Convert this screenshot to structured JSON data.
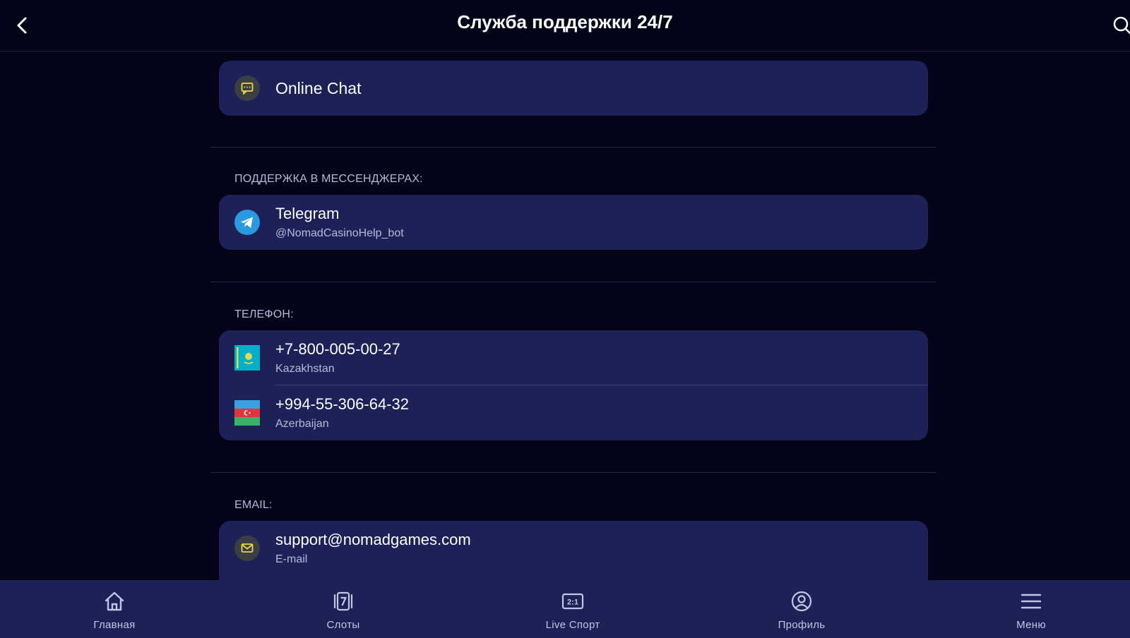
{
  "header": {
    "title": "Служба поддержки 24/7",
    "back_icon": "chevron-left-icon",
    "search_icon": "search-icon"
  },
  "online_chat": {
    "label": "Online Chat",
    "icon": "chat-icon"
  },
  "messengers": {
    "section_label": "ПОДДЕРЖКА В МЕССЕНДЖЕРАХ:",
    "items": [
      {
        "title": "Telegram",
        "subtitle": "@NomadCasinoHelp_bot",
        "icon": "telegram-icon"
      }
    ]
  },
  "phone": {
    "section_label": "ТЕЛЕФОН:",
    "items": [
      {
        "title": "+7-800-005-00-27",
        "subtitle": "Kazakhstan",
        "icon": "kazakhstan-flag-icon"
      },
      {
        "title": "+994-55-306-64-32",
        "subtitle": "Azerbaijan",
        "icon": "azerbaijan-flag-icon"
      }
    ]
  },
  "email": {
    "section_label": "EMAIL:",
    "items": [
      {
        "title": "support@nomadgames.com",
        "subtitle": "E-mail",
        "icon": "mail-icon"
      }
    ]
  },
  "nav": {
    "items": [
      {
        "label": "Главная",
        "icon": "home-icon"
      },
      {
        "label": "Слоты",
        "icon": "slots-icon"
      },
      {
        "label": "Live Спорт",
        "icon": "live-sport-icon"
      },
      {
        "label": "Профиль",
        "icon": "profile-icon"
      },
      {
        "label": "Меню",
        "icon": "menu-icon"
      }
    ]
  },
  "colors": {
    "background": "#03041a",
    "card": "#1d2158",
    "accent_yellow": "#e8d84a",
    "telegram_blue": "#2a9ae0",
    "muted_text": "#b6bad6"
  }
}
